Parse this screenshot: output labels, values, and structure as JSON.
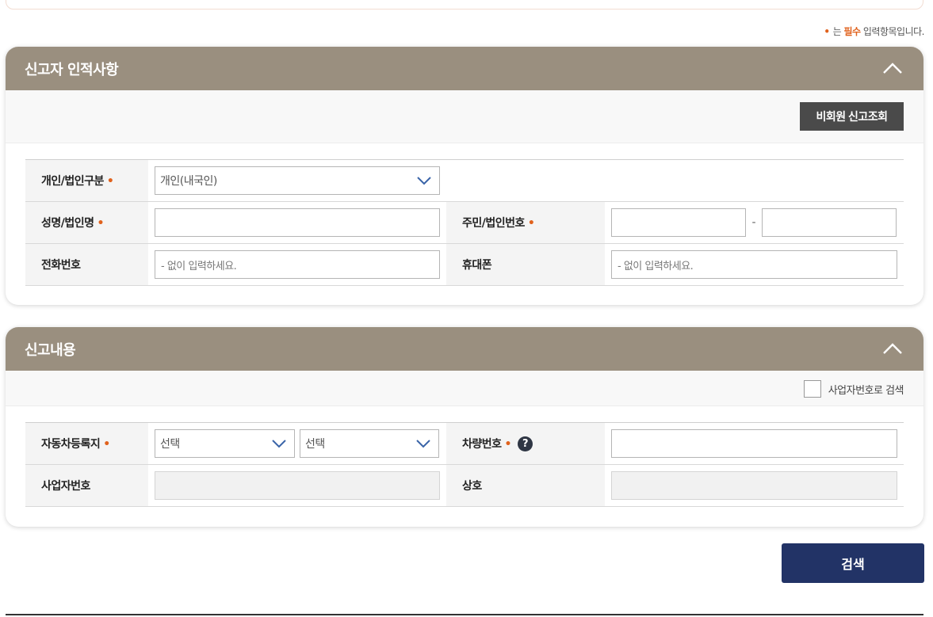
{
  "required_note": {
    "prefix": "는",
    "bold": "필수",
    "suffix": "입력항목입니다."
  },
  "section1": {
    "title": "신고자 인적사항",
    "lookup_button": "비회원 신고조회",
    "fields": {
      "type_label": "개인/법인구분",
      "type_value": "개인(내국인)",
      "name_label": "성명/법인명",
      "id_label": "주민/법인번호",
      "id_separator": "-",
      "phone_label": "전화번호",
      "phone_placeholder": "- 없이 입력하세요.",
      "mobile_label": "휴대폰",
      "mobile_placeholder": "- 없이 입력하세요."
    }
  },
  "section2": {
    "title": "신고내용",
    "checkbox_label": "사업자번호로 검색",
    "fields": {
      "region_label": "자동차등록지",
      "region_select1": "선택",
      "region_select2": "선택",
      "plate_label": "차량번호",
      "help_glyph": "?",
      "biz_label": "사업자번호",
      "company_label": "상호"
    }
  },
  "search_button": "검색",
  "colors": {
    "header_bg": "#9a8f7f",
    "required_dot": "#e0621d",
    "primary_button": "#223366",
    "dark_button": "#4a4a4a"
  }
}
